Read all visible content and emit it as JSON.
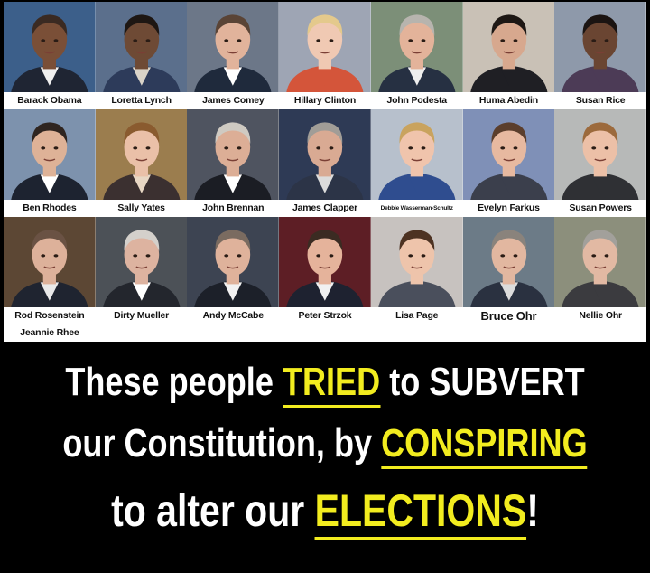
{
  "people": [
    {
      "name": "Barack Obama",
      "bg": "#3c5f8a",
      "skin": "#7a4f37",
      "hair": "#3a2a22",
      "suit": "#1f2533",
      "shirt": "#f0f0f0",
      "style": ""
    },
    {
      "name": "Loretta Lynch",
      "bg": "#5b6f8c",
      "skin": "#6e4a35",
      "hair": "#1e1713",
      "suit": "#2d3b5a",
      "shirt": "#d9d3c8",
      "style": ""
    },
    {
      "name": "James Comey",
      "bg": "#6c7788",
      "skin": "#e1b39b",
      "hair": "#5a4436",
      "suit": "#1f2a3c",
      "shirt": "#ffffff",
      "style": ""
    },
    {
      "name": "Hillary Clinton",
      "bg": "#9ea5b4",
      "skin": "#f0c9b3",
      "hair": "#e4c98c",
      "suit": "#d4553a",
      "shirt": "#d4553a",
      "style": ""
    },
    {
      "name": "John Podesta",
      "bg": "#7c8f78",
      "skin": "#e3b39a",
      "hair": "#b7b4ae",
      "suit": "#263042",
      "shirt": "#eeeeee",
      "style": ""
    },
    {
      "name": "Huma Abedin",
      "bg": "#c9c1b6",
      "skin": "#d7a88e",
      "hair": "#1d1714",
      "suit": "#1f1f24",
      "shirt": "#1f1f24",
      "style": ""
    },
    {
      "name": "Susan Rice",
      "bg": "#8e99aa",
      "skin": "#6a4532",
      "hair": "#1b1412",
      "suit": "#4c3b56",
      "shirt": "#4c3b56",
      "style": ""
    },
    {
      "name": "Ben Rhodes",
      "bg": "#7d92ad",
      "skin": "#deb297",
      "hair": "#2f2520",
      "suit": "#1d2330",
      "shirt": "#ffffff",
      "style": ""
    },
    {
      "name": "Sally Yates",
      "bg": "#9b7d4e",
      "skin": "#eac0a8",
      "hair": "#8a5b2f",
      "suit": "#3b3030",
      "shirt": "#e8d7c4",
      "style": ""
    },
    {
      "name": "John Brennan",
      "bg": "#4f5460",
      "skin": "#dcae96",
      "hair": "#cfcac2",
      "suit": "#1b1d24",
      "shirt": "#ffffff",
      "style": ""
    },
    {
      "name": "James Clapper",
      "bg": "#2e3a55",
      "skin": "#d9aa93",
      "hair": "#a19d97",
      "suit": "#2c3447",
      "shirt": "#dcdcdc",
      "style": ""
    },
    {
      "name": "Debbie Wasserman-Schultz",
      "bg": "#b7c0cc",
      "skin": "#f0c4ac",
      "hair": "#c9a35e",
      "suit": "#2f4d8f",
      "shirt": "#2f4d8f",
      "style": "tiny"
    },
    {
      "name": "Evelyn Farkus",
      "bg": "#7f90b7",
      "skin": "#e7b9a0",
      "hair": "#5b3e2c",
      "suit": "#3b3f4c",
      "shirt": "#3b3f4c",
      "style": ""
    },
    {
      "name": "Susan Powers",
      "bg": "#b7b9b8",
      "skin": "#ecc0a7",
      "hair": "#9c6a3c",
      "suit": "#2f3034",
      "shirt": "#2f3034",
      "style": ""
    },
    {
      "name": "Rod Rosenstein",
      "bg": "#5c4734",
      "skin": "#ddb19a",
      "hair": "#6a5244",
      "suit": "#1f2430",
      "shirt": "#e9e9e9",
      "style": ""
    },
    {
      "name": "Dirty Mueller",
      "bg": "#4c5157",
      "skin": "#ddb3a0",
      "hair": "#d4d0cb",
      "suit": "#23262d",
      "shirt": "#ffffff",
      "style": ""
    },
    {
      "name": "Andy McCabe",
      "bg": "#3d4452",
      "skin": "#dfb29b",
      "hair": "#7a6b60",
      "suit": "#1c2029",
      "shirt": "#f2f2f2",
      "style": ""
    },
    {
      "name": "Peter Strzok",
      "bg": "#5d1e25",
      "skin": "#e5b39b",
      "hair": "#3b2b22",
      "suit": "#1e2230",
      "shirt": "#f1f1f1",
      "style": ""
    },
    {
      "name": "Lisa Page",
      "bg": "#c7c2bf",
      "skin": "#eec4ab",
      "hair": "#4d3222",
      "suit": "#4a4f5c",
      "shirt": "#4a4f5c",
      "style": ""
    },
    {
      "name": "Bruce Ohr",
      "bg": "#6c7b87",
      "skin": "#e2b7a0",
      "hair": "#8a837c",
      "suit": "#2a3140",
      "shirt": "#dcdcdc",
      "style": "big"
    },
    {
      "name": "Nellie Ohr",
      "bg": "#8c8f7c",
      "skin": "#e2b9a3",
      "hair": "#a2a09b",
      "suit": "#3b3b3f",
      "shirt": "#3b3b3f",
      "style": ""
    },
    {
      "name": "Jeannie Rhee",
      "bg": "#b4bccb",
      "skin": "#efc9ae",
      "hair": "#3a2a20",
      "suit": "#2d2e33",
      "shirt": "#2d2e33",
      "style": ""
    }
  ],
  "headline": {
    "line1": {
      "pre": "These people ",
      "hl": "TRIED",
      "post": " to SUBVERT"
    },
    "line2": {
      "pre": "our Constitution, by ",
      "hl": "CONSPIRING",
      "post": ""
    },
    "line3": {
      "pre": "to alter our ",
      "hl": "ELECTIONS",
      "post": "!"
    }
  },
  "colors": {
    "highlight": "#f2ec1f",
    "text": "#ffffff",
    "background": "#000000"
  }
}
